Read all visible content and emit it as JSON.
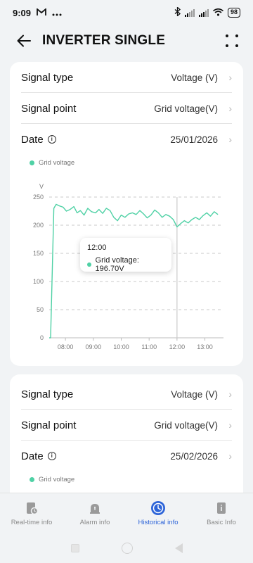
{
  "status_bar": {
    "time": "9:09",
    "left_icons": [
      "mail-icon",
      "more-dots-icon"
    ],
    "right_icons": [
      "bluetooth-icon",
      "signal-icon",
      "signal-icon",
      "wifi-icon"
    ],
    "battery": "98"
  },
  "header": {
    "title": "INVERTER SINGLE",
    "back_icon": "arrow-left-icon",
    "menu_icon": "four-dots-icon"
  },
  "card1": {
    "signal_type": {
      "label": "Signal type",
      "value": "Voltage (V)"
    },
    "signal_point": {
      "label": "Signal point",
      "value": "Grid voltage(V)"
    },
    "date": {
      "label": "Date",
      "value": "25/01/2026"
    },
    "legend": "Grid voltage"
  },
  "chart_data": {
    "type": "line",
    "ylabel": "V",
    "ylim": [
      0,
      250
    ],
    "y_ticks": [
      "0",
      "50",
      "100",
      "150",
      "200",
      "250"
    ],
    "x_ticks": [
      "08:00",
      "09:00",
      "10:00",
      "11:00",
      "12:00",
      "13:00"
    ],
    "grid": true,
    "series": [
      {
        "name": "Grid voltage",
        "color": "#4fd1a5",
        "points": [
          [
            "07:25",
            0
          ],
          [
            "07:28",
            0
          ],
          [
            "07:35",
            230
          ],
          [
            "07:40",
            237
          ],
          [
            "07:48",
            234
          ],
          [
            "07:55",
            232
          ],
          [
            "08:02",
            225
          ],
          [
            "08:10",
            228
          ],
          [
            "08:18",
            233
          ],
          [
            "08:25",
            222
          ],
          [
            "08:32",
            226
          ],
          [
            "08:40",
            218
          ],
          [
            "08:48",
            230
          ],
          [
            "08:56",
            224
          ],
          [
            "09:05",
            222
          ],
          [
            "09:12",
            228
          ],
          [
            "09:20",
            221
          ],
          [
            "09:28",
            230
          ],
          [
            "09:36",
            226
          ],
          [
            "09:44",
            214
          ],
          [
            "09:52",
            208
          ],
          [
            "10:00",
            218
          ],
          [
            "10:08",
            214
          ],
          [
            "10:16",
            220
          ],
          [
            "10:24",
            222
          ],
          [
            "10:32",
            219
          ],
          [
            "10:40",
            226
          ],
          [
            "10:48",
            220
          ],
          [
            "10:56",
            213
          ],
          [
            "11:04",
            218
          ],
          [
            "11:12",
            227
          ],
          [
            "11:20",
            222
          ],
          [
            "11:28",
            214
          ],
          [
            "11:36",
            219
          ],
          [
            "11:44",
            216
          ],
          [
            "11:52",
            210
          ],
          [
            "12:00",
            197
          ],
          [
            "12:08",
            203
          ],
          [
            "12:16",
            208
          ],
          [
            "12:24",
            204
          ],
          [
            "12:32",
            210
          ],
          [
            "12:40",
            214
          ],
          [
            "12:48",
            210
          ],
          [
            "12:56",
            217
          ],
          [
            "13:04",
            222
          ],
          [
            "13:12",
            216
          ],
          [
            "13:20",
            224
          ],
          [
            "13:28",
            219
          ]
        ]
      }
    ],
    "cursor_x": "12:00",
    "tooltip": {
      "time": "12:00",
      "text": "Grid voltage: 196.70V"
    }
  },
  "card2": {
    "signal_type": {
      "label": "Signal type",
      "value": "Voltage (V)"
    },
    "signal_point": {
      "label": "Signal point",
      "value": "Grid voltage(V)"
    },
    "date": {
      "label": "Date",
      "value": "25/02/2026"
    },
    "legend": "Grid voltage"
  },
  "bottom_nav": [
    {
      "label": "Real-time info",
      "icon": "realtime-info-icon",
      "active": false
    },
    {
      "label": "Alarm info",
      "icon": "alarm-bell-icon",
      "active": false
    },
    {
      "label": "Historical info",
      "icon": "clock-icon",
      "active": true
    },
    {
      "label": "Basic Info",
      "icon": "document-info-icon",
      "active": false
    }
  ],
  "colors": {
    "accent": "#2d64d8",
    "series": "#4fd1a5",
    "background": "#f1f3f5"
  }
}
